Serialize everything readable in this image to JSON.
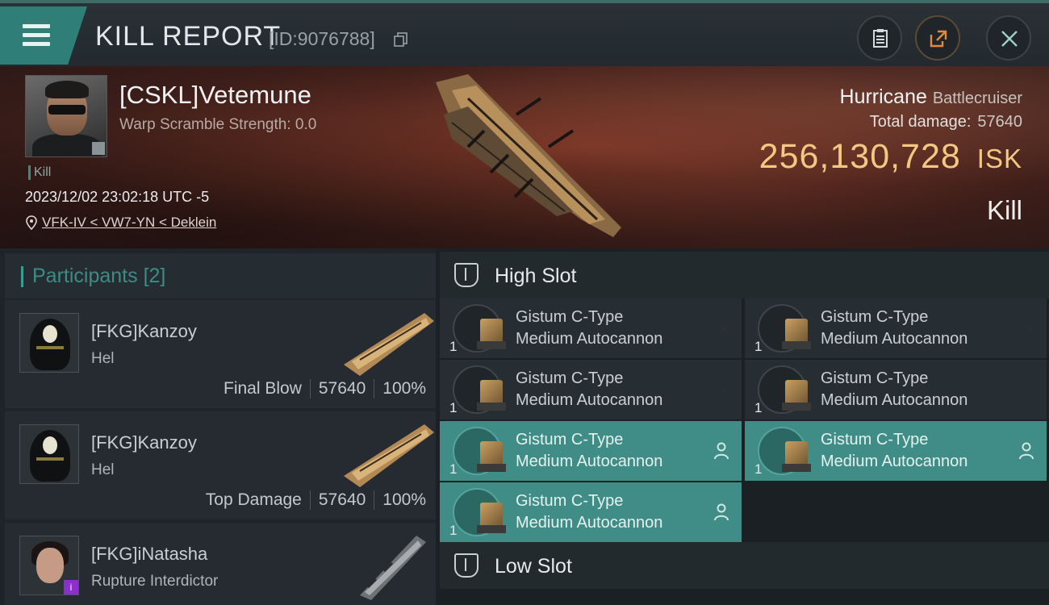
{
  "header": {
    "title": "KILL REPORT",
    "id_text": "[ID:9076788]"
  },
  "victim": {
    "name": "[CSKL]Vetemune",
    "warp_scramble": "Warp Scramble Strength: 0.0",
    "tag": "Kill",
    "timestamp": "2023/12/02 23:02:18 UTC -5",
    "location": "VFK-IV < VW7-YN < Deklein",
    "ship_name": "Hurricane",
    "ship_class": "Battlecruiser",
    "total_damage_label": "Total damage:",
    "total_damage": "57640",
    "isk_value": "256,130,728",
    "isk_unit": "ISK",
    "result": "Kill"
  },
  "participants": {
    "label": "Participants",
    "count": "[2]",
    "rows": [
      {
        "name": "[FKG]Kanzoy",
        "ship": "Hel",
        "role": "Final Blow",
        "damage": "57640",
        "percent": "100%"
      },
      {
        "name": "[FKG]Kanzoy",
        "ship": "Hel",
        "role": "Top Damage",
        "damage": "57640",
        "percent": "100%"
      },
      {
        "name": "[FKG]iNatasha",
        "ship": "Rupture Interdictor",
        "role": "",
        "damage": "",
        "percent": ""
      }
    ]
  },
  "fitting": {
    "high_slot_label": "High Slot",
    "low_slot_label": "Low Slot",
    "modules": [
      {
        "line1": "Gistum C-Type",
        "line2": "Medium Autocannon",
        "qty": "1",
        "state": "destroyed"
      },
      {
        "line1": "Gistum C-Type",
        "line2": "Medium Autocannon",
        "qty": "1",
        "state": "destroyed"
      },
      {
        "line1": "Gistum C-Type",
        "line2": "Medium Autocannon",
        "qty": "1",
        "state": "destroyed"
      },
      {
        "line1": "Gistum C-Type",
        "line2": "Medium Autocannon",
        "qty": "1",
        "state": "destroyed"
      },
      {
        "line1": "Gistum C-Type",
        "line2": "Medium Autocannon",
        "qty": "1",
        "state": "dropped"
      },
      {
        "line1": "Gistum C-Type",
        "line2": "Medium Autocannon",
        "qty": "1",
        "state": "dropped"
      },
      {
        "line1": "Gistum C-Type",
        "line2": "Medium Autocannon",
        "qty": "1",
        "state": "dropped"
      }
    ]
  },
  "icons": {
    "menu": "hamburger-menu-icon",
    "copy": "copy-icon",
    "clipboard": "clipboard-icon",
    "share": "share-icon",
    "close": "close-icon",
    "location": "location-pin-icon",
    "destroyed": "x-icon",
    "dropped": "person-icon"
  },
  "colors": {
    "accent": "#3f8d86",
    "isk": "#f4c883"
  }
}
